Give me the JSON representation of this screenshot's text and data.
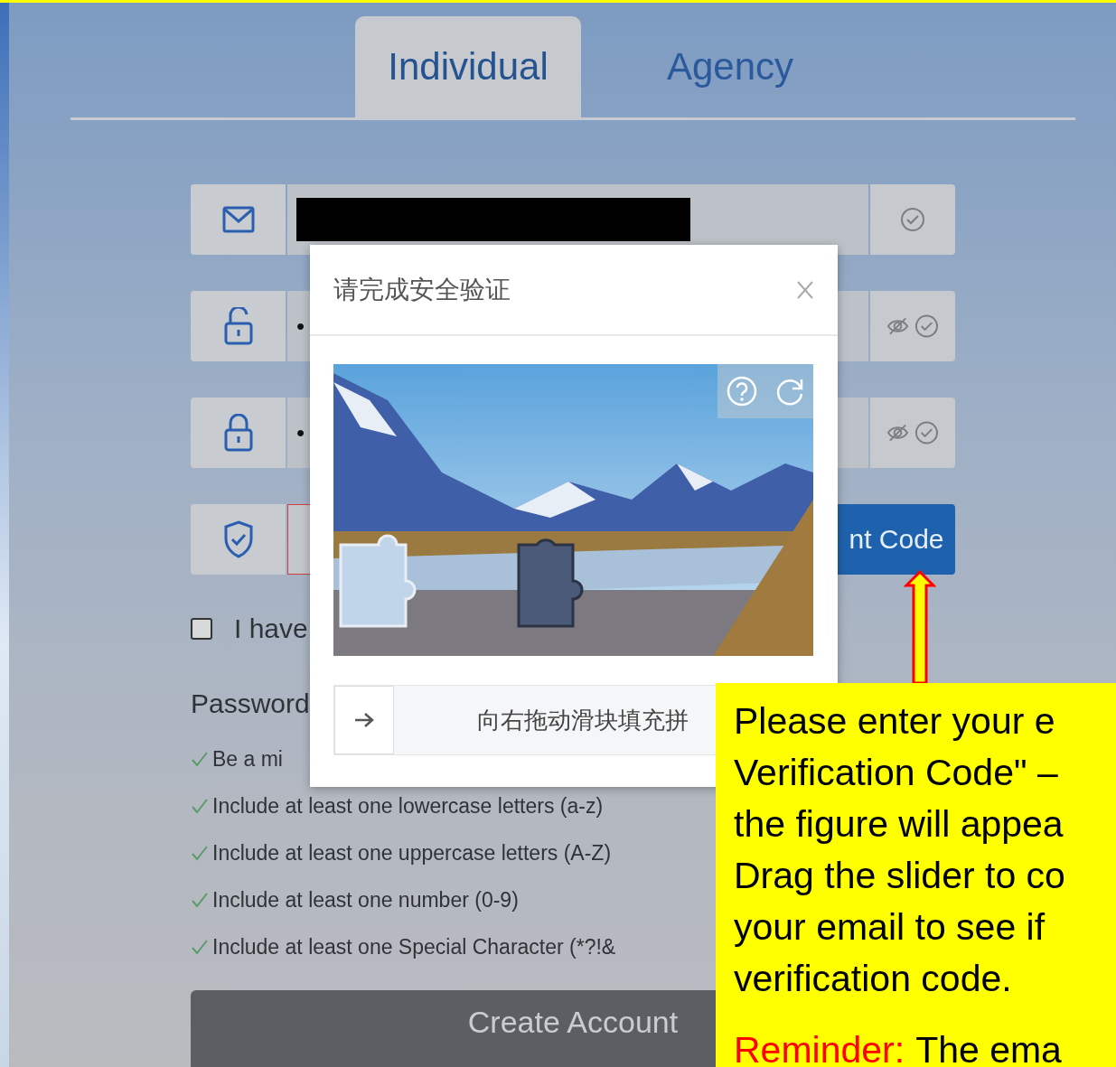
{
  "tabs": [
    {
      "label": "Individual",
      "selected": true
    },
    {
      "label": "Agency",
      "selected": false
    }
  ],
  "form": {
    "fields": [
      {
        "kind": "email",
        "redacted": true
      },
      {
        "kind": "password",
        "value": "•"
      },
      {
        "kind": "confirm",
        "value": "•"
      },
      {
        "kind": "code",
        "button": "nt Code"
      }
    ],
    "agreement": {
      "label": "I have",
      "checked": false
    },
    "password_rules": {
      "title": "Password",
      "rules": [
        {
          "text": "Be a mi",
          "met": true
        },
        {
          "text": "Include at least one lowercase letters (a-z)",
          "met": true
        },
        {
          "text": "Include at least one uppercase letters (A-Z)",
          "met": true
        },
        {
          "text": "Include at least one number (0-9)",
          "met": true
        },
        {
          "text": "Include at least one Special Character (*?!&",
          "met": true
        }
      ]
    },
    "create_button": "Create Account"
  },
  "dialog": {
    "title": "请完成安全验证",
    "slider_hint": "向右拖动滑块填充拼"
  },
  "callout": {
    "lines": [
      "Please enter your e",
      "Verification Code\" –",
      "the figure will appea",
      "Drag the slider to co",
      "your email to see if",
      "verification code."
    ],
    "reminder": {
      "label": "Reminder:",
      "text": "The ema"
    }
  }
}
